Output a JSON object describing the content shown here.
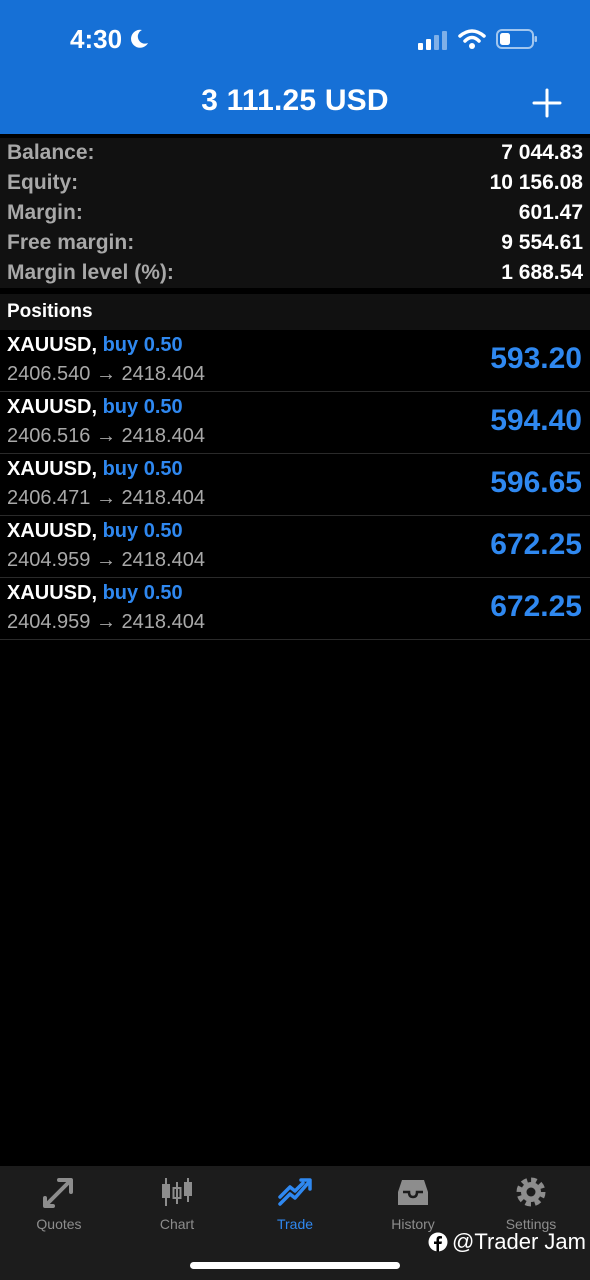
{
  "status_bar": {
    "time": "4:30"
  },
  "header": {
    "title": "3 111.25 USD"
  },
  "account": [
    {
      "label": "Balance:",
      "value": "7 044.83"
    },
    {
      "label": "Equity:",
      "value": "10 156.08"
    },
    {
      "label": "Margin:",
      "value": "601.47"
    },
    {
      "label": "Free margin:",
      "value": "9 554.61"
    },
    {
      "label": "Margin level (%):",
      "value": "1 688.54"
    }
  ],
  "positions_title": "Positions",
  "positions": [
    {
      "symbol": "XAUUSD,",
      "side": "buy 0.50",
      "prices": "2406.540 → 2418.404",
      "profit": "593.20"
    },
    {
      "symbol": "XAUUSD,",
      "side": "buy 0.50",
      "prices": "2406.516 → 2418.404",
      "profit": "594.40"
    },
    {
      "symbol": "XAUUSD,",
      "side": "buy 0.50",
      "prices": "2406.471 → 2418.404",
      "profit": "596.65"
    },
    {
      "symbol": "XAUUSD,",
      "side": "buy 0.50",
      "prices": "2404.959 → 2418.404",
      "profit": "672.25"
    },
    {
      "symbol": "XAUUSD,",
      "side": "buy 0.50",
      "prices": "2404.959 → 2418.404",
      "profit": "672.25"
    }
  ],
  "tabs": [
    {
      "label": "Quotes",
      "icon": "quotes-icon"
    },
    {
      "label": "Chart",
      "icon": "chart-icon"
    },
    {
      "label": "Trade",
      "icon": "trade-icon",
      "active": true
    },
    {
      "label": "History",
      "icon": "history-icon"
    },
    {
      "label": "Settings",
      "icon": "settings-icon"
    }
  ],
  "watermark": "@Trader Jam",
  "colors": {
    "header_bg": "#1670d6",
    "accent": "#2f88f0",
    "muted_text": "#a9a9a9"
  }
}
